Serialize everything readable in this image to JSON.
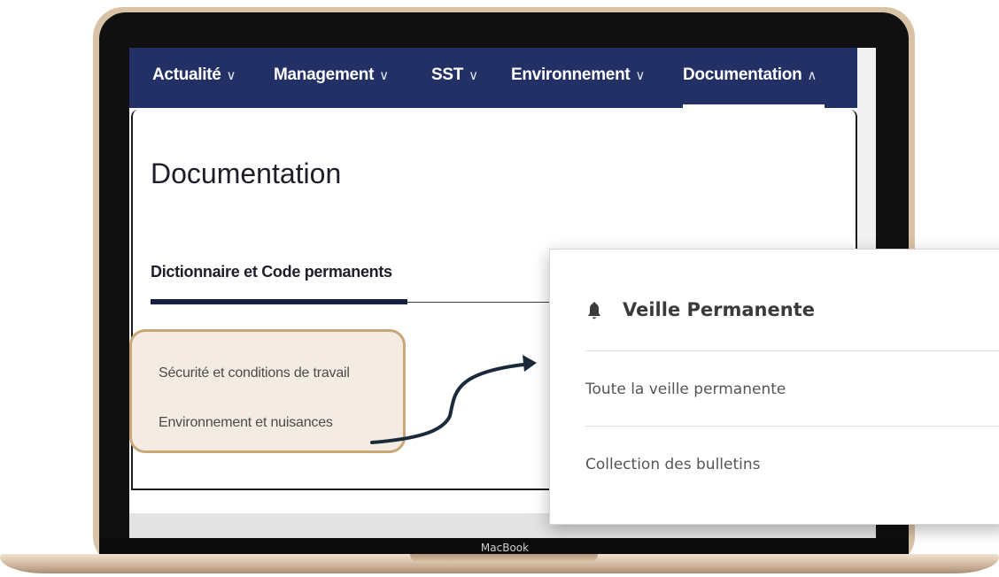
{
  "laptop": {
    "brand": "MacBook"
  },
  "nav": {
    "items": [
      {
        "label": "Actualité",
        "chevron": "∨"
      },
      {
        "label": "Management",
        "chevron": "∨"
      },
      {
        "label": "SST",
        "chevron": "∨"
      },
      {
        "label": "Environnement",
        "chevron": "∨"
      },
      {
        "label": "Documentation",
        "chevron": "∧",
        "active": true
      }
    ],
    "bar_color": "#233066"
  },
  "page": {
    "title": "Documentation",
    "section_tab": "Dictionnaire et Code permanents",
    "links": [
      "Sécurité et conditions de travail",
      "Environnement et nuisances"
    ],
    "highlight_color": "#c9a777"
  },
  "dropdown": {
    "header_icon": "bell-icon",
    "header": "Veille Permanente",
    "items": [
      "Toute la veille permanente",
      "Collection des bulletins"
    ]
  }
}
